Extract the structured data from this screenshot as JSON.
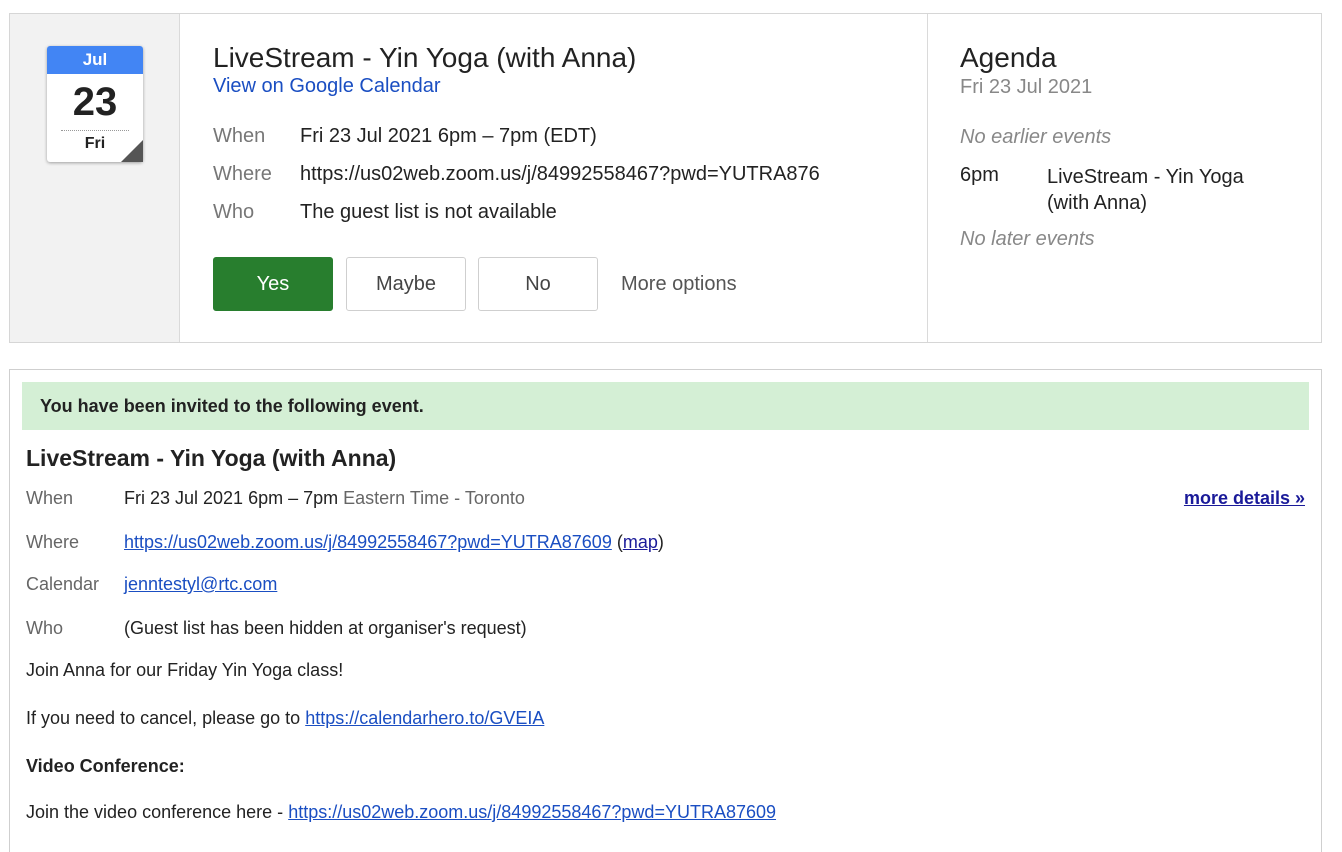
{
  "calendar_icon": {
    "month": "Jul",
    "day": "23",
    "weekday": "Fri",
    "colors": {
      "header": "#4285f4"
    }
  },
  "event": {
    "title": "LiveStream - Yin Yoga (with Anna)",
    "view_link": "View on Google Calendar",
    "rows": [
      {
        "label": "When",
        "value": "Fri 23 Jul 2021 6pm – 7pm (EDT)"
      },
      {
        "label": "Where",
        "value": "https://us02web.zoom.us/j/84992558467?pwd=YUTRA876"
      },
      {
        "label": "Who",
        "value": "The guest list is not available"
      }
    ],
    "rsvp": {
      "yes": "Yes",
      "maybe": "Maybe",
      "no": "No",
      "more": "More options"
    },
    "colors": {
      "yes_button": "#287e2e",
      "link": "#1a4ec2"
    }
  },
  "agenda": {
    "title": "Agenda",
    "date": "Fri 23 Jul 2021",
    "no_earlier": "No earlier events",
    "item_time": "6pm",
    "item_title": "LiveStream - Yin Yoga (with Anna)",
    "no_later": "No later events"
  },
  "email": {
    "banner": "You have been invited to the following event.",
    "banner_color": "#d4efd5",
    "title": "LiveStream - Yin Yoga (with Anna)",
    "more_details": "more details »",
    "when_label": "When",
    "when_value": "Fri 23 Jul 2021 6pm – 7pm",
    "when_tz": "Eastern Time - Toronto",
    "where_label": "Where",
    "where_link": "https://us02web.zoom.us/j/84992558467?pwd=YUTRA87609",
    "map_open": "(",
    "map_link": "map",
    "map_close": ")",
    "calendar_label": "Calendar",
    "calendar_value": "jenntestyl@rtc.com",
    "who_label": "Who",
    "who_value": "(Guest list has been hidden at organiser's request)",
    "description": "Join Anna for our Friday Yin Yoga class!",
    "cancel_text": "If you need to cancel, please go to",
    "cancel_link": "https://calendarhero.to/GVEIA",
    "video_heading": "Video Conference:",
    "video_text": "Join the video conference here -",
    "video_link": "https://us02web.zoom.us/j/84992558467?pwd=YUTRA87609"
  }
}
